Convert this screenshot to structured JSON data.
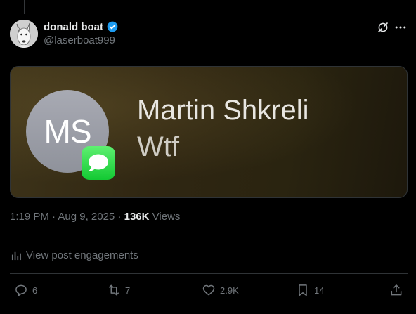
{
  "post": {
    "author": {
      "display_name": "donald boat",
      "handle": "@laserboat999",
      "verified": true
    },
    "media": {
      "initials": "MS",
      "contact_name": "Martin Shkreli",
      "message": "Wtf",
      "badge_icon": "imessage-icon"
    },
    "meta": {
      "timestamp": "1:19 PM · Aug 9, 2025",
      "separator": " · ",
      "views_count": "136K",
      "views_label": "Views"
    },
    "engagements_link": "View post engagements",
    "actions": {
      "replies": "6",
      "reposts": "7",
      "likes": "2.9K",
      "bookmarks": "14"
    }
  },
  "colors": {
    "background": "#000000",
    "primary_text": "#e7e9ea",
    "secondary_text": "#71767b",
    "verified_blue": "#1d9bf0",
    "imessage_green": "#13c933",
    "divider": "#2f3336"
  }
}
